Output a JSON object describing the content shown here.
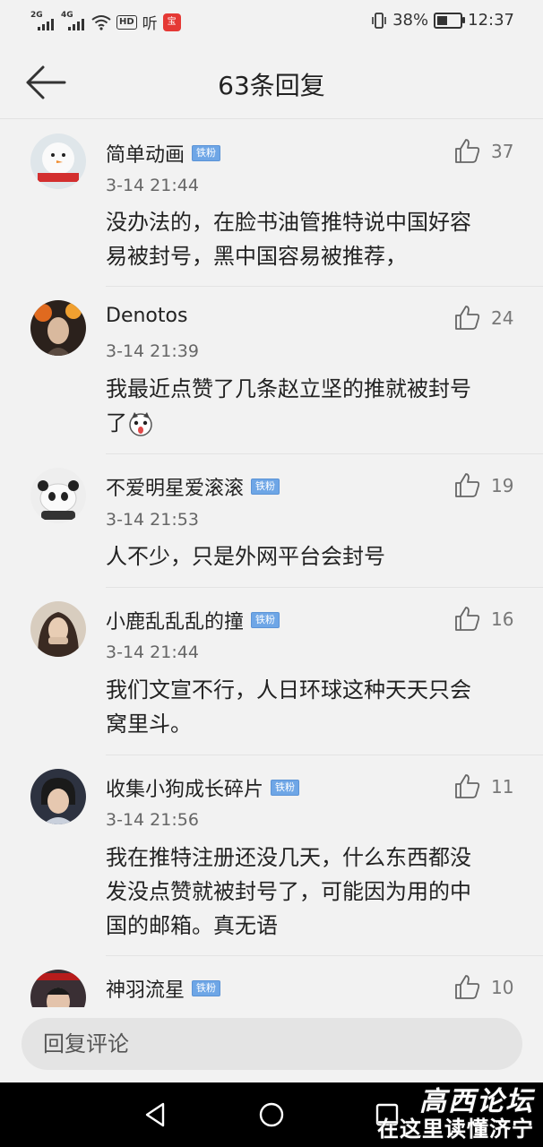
{
  "status_bar": {
    "signal1_gen": "2G",
    "signal2_gen": "4G",
    "hd": "HD",
    "ting": "听",
    "app_badge": "宝",
    "battery": "38%",
    "time": "12:37"
  },
  "header": {
    "title": "63条回复"
  },
  "comments": [
    {
      "name": "简单动画",
      "badge": "铁粉",
      "time": "3-14 21:44",
      "likes": "37",
      "text": [
        "没办法的，在脸书油管推特说中国好容",
        "易被封号，黑中国容易被推荐，"
      ]
    },
    {
      "name": "Denotos",
      "badge": "",
      "time": "3-14 21:39",
      "likes": "24",
      "text": [
        "我最近点赞了几条赵立坚的推就被封号",
        "了"
      ]
    },
    {
      "name": "不爱明星爱滚滚",
      "badge": "铁粉",
      "time": "3-14 21:53",
      "likes": "19",
      "text": [
        "人不少，只是外网平台会封号"
      ]
    },
    {
      "name": "小鹿乱乱乱的撞",
      "badge": "铁粉",
      "time": "3-14 21:44",
      "likes": "16",
      "text": [
        "我们文宣不行，人日环球这种天天只会",
        "窝里斗。"
      ]
    },
    {
      "name": "收集小狗成长碎片",
      "badge": "铁粉",
      "time": "3-14 21:56",
      "likes": "11",
      "text": [
        "我在推特注册还没几天，什么东西都没",
        "发没点赞就被封号了，可能因为用的中",
        "国的邮箱。真无语"
      ]
    },
    {
      "name": "神羽流星",
      "badge": "铁粉",
      "time": "",
      "likes": "10",
      "text": []
    }
  ],
  "reply": {
    "placeholder": "回复评论"
  },
  "watermark": {
    "line1": "高西论坛",
    "line2": "在这里读懂济宁"
  },
  "colors": {
    "background": "#f2f2f2",
    "badge": "#6ea6e6",
    "navbar": "#000000"
  },
  "icons": [
    "back-arrow-icon",
    "thumbs-up-icon",
    "nav-back-icon",
    "nav-home-icon",
    "nav-recents-icon"
  ]
}
